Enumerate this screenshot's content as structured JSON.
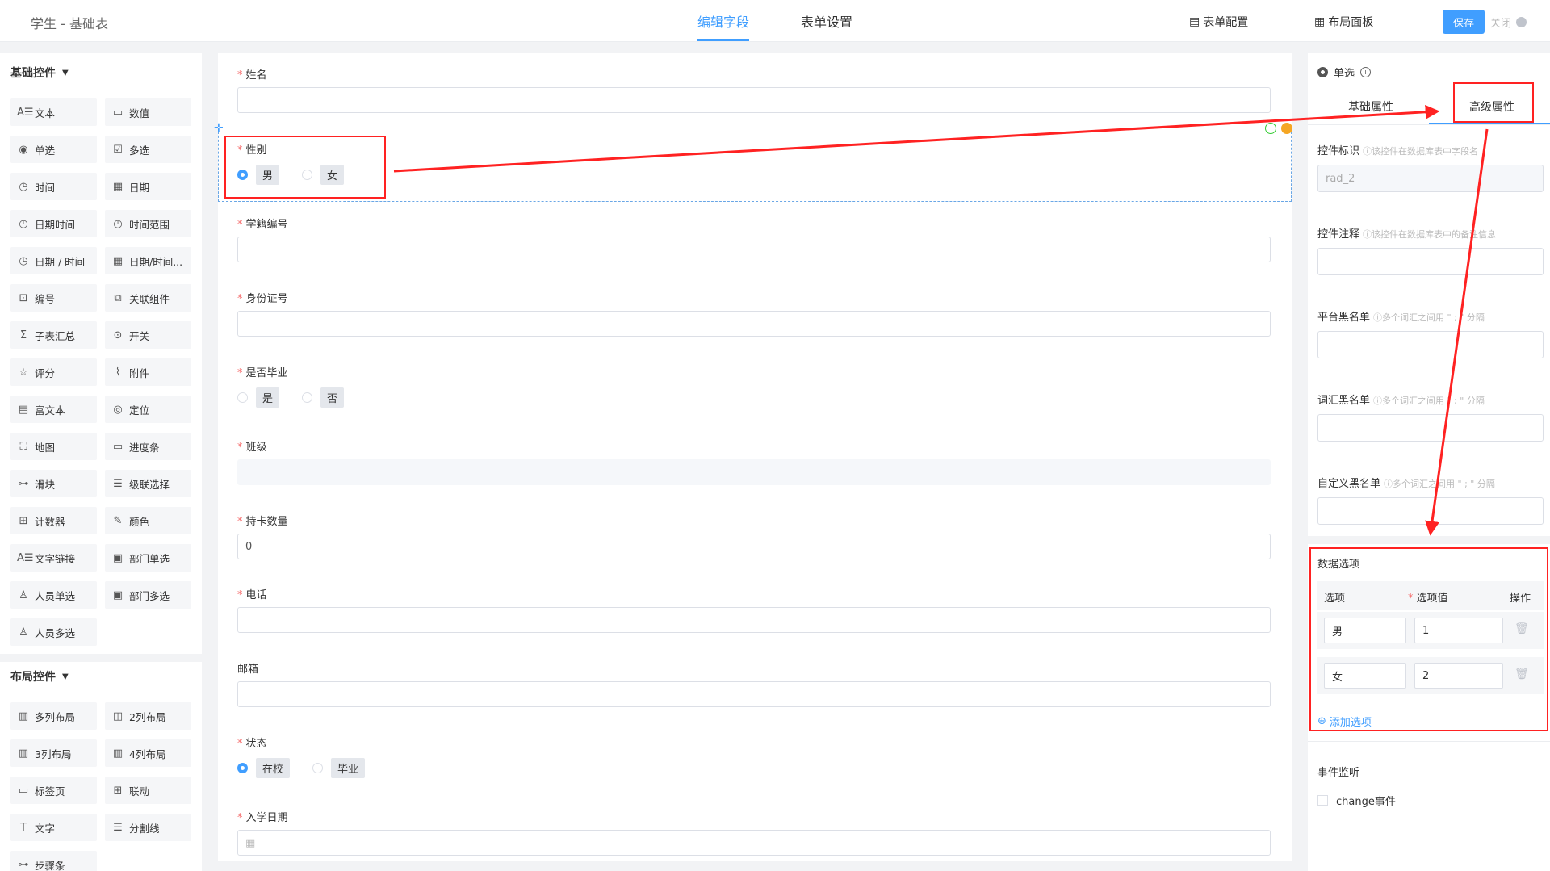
{
  "header": {
    "title": "学生 - 基础表",
    "tabs": [
      {
        "label": "编辑字段"
      },
      {
        "label": "表单设置"
      }
    ],
    "form_config": "表单配置",
    "layout_panel": "布局面板",
    "save": "保存",
    "close": "关闭"
  },
  "left": {
    "basic_title": "基础控件",
    "basic": [
      {
        "label": "文本",
        "icon": "A☰"
      },
      {
        "label": "数值",
        "icon": "▭"
      },
      {
        "label": "单选",
        "icon": "◉"
      },
      {
        "label": "多选",
        "icon": "☑"
      },
      {
        "label": "时间",
        "icon": "◷"
      },
      {
        "label": "日期",
        "icon": "▦"
      },
      {
        "label": "日期时间",
        "icon": "◷"
      },
      {
        "label": "时间范围",
        "icon": "◷"
      },
      {
        "label": "日期 / 时间",
        "icon": "◷"
      },
      {
        "label": "日期/时间...",
        "icon": "▦"
      },
      {
        "label": "编号",
        "icon": "⊡"
      },
      {
        "label": "关联组件",
        "icon": "⧉"
      },
      {
        "label": "子表汇总",
        "icon": "Σ"
      },
      {
        "label": "开关",
        "icon": "⊙"
      },
      {
        "label": "评分",
        "icon": "☆"
      },
      {
        "label": "附件",
        "icon": "⌇"
      },
      {
        "label": "富文本",
        "icon": "▤"
      },
      {
        "label": "定位",
        "icon": "◎"
      },
      {
        "label": "地图",
        "icon": "⛶"
      },
      {
        "label": "进度条",
        "icon": "▭"
      },
      {
        "label": "滑块",
        "icon": "⊶"
      },
      {
        "label": "级联选择",
        "icon": "☰"
      },
      {
        "label": "计数器",
        "icon": "⊞"
      },
      {
        "label": "颜色",
        "icon": "✎"
      },
      {
        "label": "文字链接",
        "icon": "A☰"
      },
      {
        "label": "部门单选",
        "icon": "▣"
      },
      {
        "label": "人员单选",
        "icon": "♙"
      },
      {
        "label": "部门多选",
        "icon": "▣"
      },
      {
        "label": "人员多选",
        "icon": "♙"
      }
    ],
    "layout_title": "布局控件",
    "layout": [
      {
        "label": "多列布局",
        "icon": "▥"
      },
      {
        "label": "2列布局",
        "icon": "◫"
      },
      {
        "label": "3列布局",
        "icon": "▥"
      },
      {
        "label": "4列布局",
        "icon": "▥"
      },
      {
        "label": "标签页",
        "icon": "▭"
      },
      {
        "label": "联动",
        "icon": "⊞"
      },
      {
        "label": "文字",
        "icon": "T"
      },
      {
        "label": "分割线",
        "icon": "☰"
      },
      {
        "label": "步骤条",
        "icon": "⊶"
      }
    ]
  },
  "form": {
    "fields": [
      {
        "label": "姓名",
        "required": true,
        "type": "input",
        "value": ""
      },
      {
        "label": "性别",
        "required": true,
        "type": "radio",
        "options": [
          "男",
          "女"
        ],
        "selected": 0
      },
      {
        "label": "学籍编号",
        "required": true,
        "type": "input",
        "value": ""
      },
      {
        "label": "身份证号",
        "required": true,
        "type": "input",
        "value": ""
      },
      {
        "label": "是否毕业",
        "required": true,
        "type": "radio",
        "options": [
          "是",
          "否"
        ],
        "selected": -1
      },
      {
        "label": "班级",
        "required": true,
        "type": "grey",
        "value": ""
      },
      {
        "label": "持卡数量",
        "required": true,
        "type": "input",
        "value": "0"
      },
      {
        "label": "电话",
        "required": true,
        "type": "input",
        "value": ""
      },
      {
        "label": "邮箱",
        "required": false,
        "type": "input",
        "value": ""
      },
      {
        "label": "状态",
        "required": true,
        "type": "radio",
        "options": [
          "在校",
          "毕业"
        ],
        "selected": 0
      },
      {
        "label": "入学日期",
        "required": true,
        "type": "date",
        "value": ""
      }
    ]
  },
  "props": {
    "widget_name": "单选",
    "tab_basic": "基础属性",
    "tab_advanced": "高级属性",
    "id_label": "控件标识",
    "id_hint": "ⓘ该控件在数据库表中字段名",
    "id_value": "rad_2",
    "comment_label": "控件注释",
    "comment_hint": "ⓘ该控件在数据库表中的备注信息",
    "platform_bl_label": "平台黑名单",
    "platform_bl_hint": "ⓘ多个词汇之间用 \" ; \" 分隔",
    "vocab_bl_label": "词汇黑名单",
    "vocab_bl_hint": "ⓘ多个词汇之间用 \" ; \" 分隔",
    "custom_bl_label": "自定义黑名单",
    "custom_bl_hint": "ⓘ多个词汇之间用 \" ; \" 分隔",
    "options_title": "数据选项",
    "col_option": "选项",
    "col_value": "选项值",
    "col_action": "操作",
    "options": [
      {
        "label": "男",
        "value": "1"
      },
      {
        "label": "女",
        "value": "2"
      }
    ],
    "add_option": "添加选项",
    "events_title": "事件监听",
    "change_event": "change事件"
  },
  "colors": {
    "accent": "#409eff",
    "annotation": "#ff2222",
    "required": "#f56c6c"
  }
}
